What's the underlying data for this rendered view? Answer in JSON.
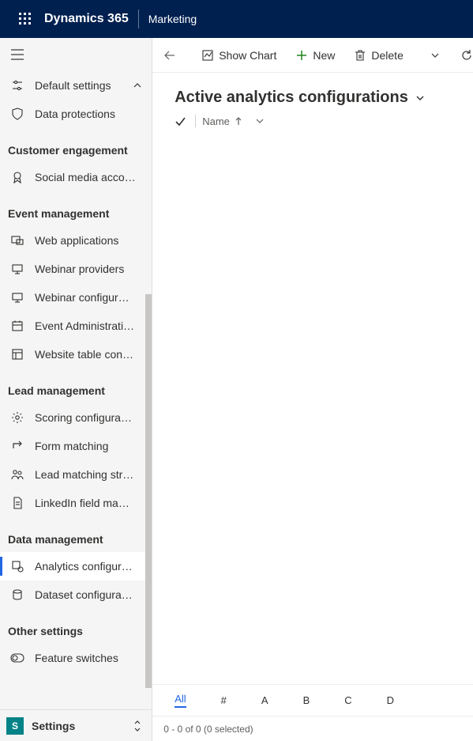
{
  "topbar": {
    "product": "Dynamics 365",
    "area": "Marketing"
  },
  "nav": {
    "default_settings": "Default settings",
    "data_protections": "Data protections",
    "groups": [
      {
        "header": "Customer engagement",
        "items": [
          {
            "label": "Social media acco…",
            "icon": "ribbon"
          }
        ]
      },
      {
        "header": "Event management",
        "items": [
          {
            "label": "Web applications",
            "icon": "webapp"
          },
          {
            "label": "Webinar providers",
            "icon": "device"
          },
          {
            "label": "Webinar configur…",
            "icon": "device"
          },
          {
            "label": "Event Administrati…",
            "icon": "calendar"
          },
          {
            "label": "Website table con…",
            "icon": "layout"
          }
        ]
      },
      {
        "header": "Lead management",
        "items": [
          {
            "label": "Scoring configura…",
            "icon": "gear"
          },
          {
            "label": "Form matching",
            "icon": "match"
          },
          {
            "label": "Lead matching str…",
            "icon": "people"
          },
          {
            "label": "LinkedIn field ma…",
            "icon": "doc"
          }
        ]
      },
      {
        "header": "Data management",
        "items": [
          {
            "label": "Analytics configur…",
            "icon": "analytics",
            "selected": true
          },
          {
            "label": "Dataset configura…",
            "icon": "dataset"
          }
        ]
      },
      {
        "header": "Other settings",
        "items": [
          {
            "label": "Feature switches",
            "icon": "toggle"
          }
        ]
      }
    ]
  },
  "area_switcher": {
    "tile_letter": "S",
    "label": "Settings"
  },
  "commands": {
    "show_chart": "Show Chart",
    "new": "New",
    "delete": "Delete"
  },
  "view": {
    "title": "Active analytics configurations",
    "columns": {
      "name": "Name"
    },
    "letters": [
      "All",
      "#",
      "A",
      "B",
      "C",
      "D"
    ],
    "footer": "0 - 0 of 0 (0 selected)"
  }
}
